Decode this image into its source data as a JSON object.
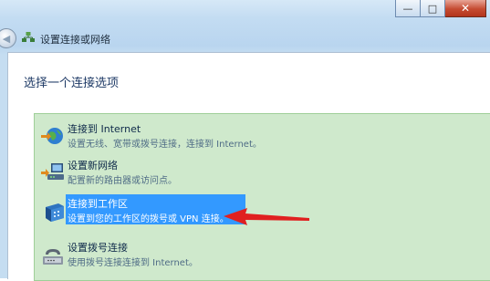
{
  "window": {
    "minimize_glyph": "—",
    "maximize_glyph": "□",
    "close_glyph": "✕"
  },
  "navbar": {
    "back_glyph": "◀",
    "title": "设置连接或网络",
    "icon": "network-wizard-icon"
  },
  "content": {
    "heading": "选择一个连接选项"
  },
  "options": [
    {
      "title": "连接到 Internet",
      "desc": "设置无线、宽带或拨号连接，连接到 Internet。",
      "icon": "globe-icon",
      "selected": false
    },
    {
      "title": "设置新网络",
      "desc": "配置新的路由器或访问点。",
      "icon": "router-icon",
      "selected": false
    },
    {
      "title": "连接到工作区",
      "desc": "设置到您的工作区的拨号或 VPN 连接。",
      "icon": "workplace-icon",
      "selected": true
    },
    {
      "title": "设置拨号连接",
      "desc": "使用拨号连接连接到 Internet。",
      "icon": "phone-modem-icon",
      "selected": false
    }
  ],
  "annotation": {
    "arrow_color": "#e02020"
  },
  "colors": {
    "list_background": "#cfe9cc",
    "selection": "#3399ff",
    "heading_text": "#1e3a66"
  }
}
